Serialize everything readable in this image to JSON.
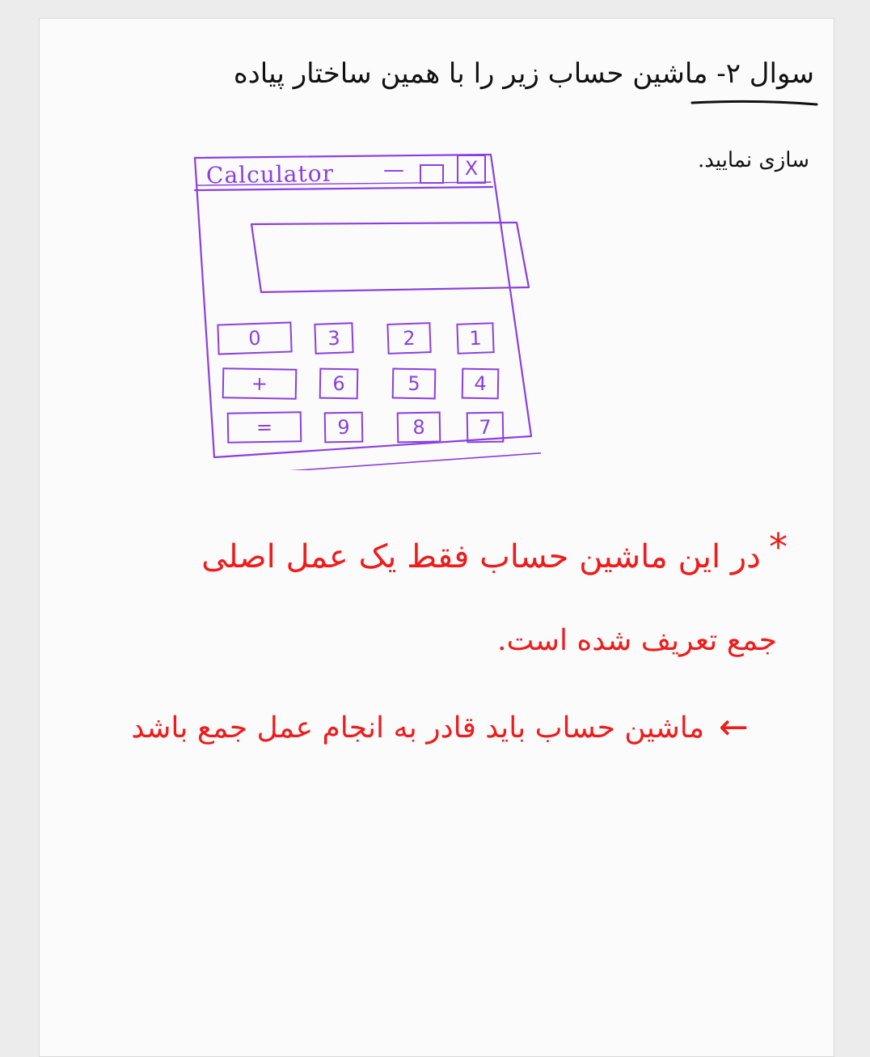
{
  "question": {
    "line1": "سوال ۲- ماشین حساب زیر را با همین ساختار پیاده",
    "line2": "سازی نمایید."
  },
  "calculator": {
    "title": "Calculator",
    "controls": {
      "minimize": "—",
      "maximize": "☐",
      "close": "X"
    },
    "display_value": "",
    "rows": [
      [
        {
          "label": "0",
          "name": "key-0"
        },
        {
          "label": "3",
          "name": "key-3"
        },
        {
          "label": "2",
          "name": "key-2"
        },
        {
          "label": "1",
          "name": "key-1"
        }
      ],
      [
        {
          "label": "+",
          "name": "key-plus"
        },
        {
          "label": "6",
          "name": "key-6"
        },
        {
          "label": "5",
          "name": "key-5"
        },
        {
          "label": "4",
          "name": "key-4"
        }
      ],
      [
        {
          "label": "=",
          "name": "key-equals"
        },
        {
          "label": "9",
          "name": "key-9"
        },
        {
          "label": "8",
          "name": "key-8"
        },
        {
          "label": "7",
          "name": "key-7"
        }
      ]
    ]
  },
  "notes": {
    "star_marker": "*",
    "note1_line1": "در این ماشین حساب فقط یک عمل اصلی",
    "note1_line2": "جمع تعریف شده است.",
    "arrow_marker": "←",
    "note2": "ماشین حساب باید قادر به انجام عمل جمع باشد"
  },
  "colors": {
    "ink_black": "#111111",
    "ink_purple": "#8a3fe0",
    "ink_red": "#ee1c1c"
  }
}
